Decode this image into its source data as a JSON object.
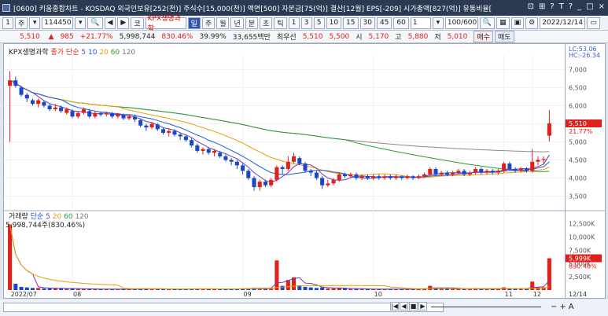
{
  "window": {
    "title": "[0600] 키움종합차트 - KOSDAQ 외국인보유[252(천)] 주식수[15,000(천)] 액면[500] 자본금[75(억)] 결산[12월] EPS[-209] 시가총액[827(억)] 유통비율[",
    "controls": [
      "⊡",
      "⊞",
      "?",
      "T",
      "?",
      "_",
      "□",
      "×"
    ]
  },
  "toolbar": {
    "left_buttons": [
      "1",
      "주",
      "▾"
    ],
    "stock_code": "114450",
    "period_buttons": [
      "코",
      "KPX생명과학",
      "일",
      "주",
      "월",
      "년",
      "분",
      "초",
      "틱"
    ],
    "interval_buttons": [
      "1",
      "3",
      "5",
      "10",
      "15",
      "30",
      "45",
      "60"
    ],
    "interval_value": "1",
    "page_count": "100/600",
    "date": "2022/12/14"
  },
  "quote": {
    "price": "5,510",
    "change": "985",
    "change_pct": "+21.77%",
    "volume": "5,998,744",
    "vol_ratio": "830.46%",
    "turnover": "39.99%",
    "amount": "33,655백만",
    "best_ask_label": "최우선",
    "best_ask": "5,510",
    "best_bid": "5,500",
    "open_label": "시",
    "open": "5,170",
    "high_label": "고",
    "high": "5,880",
    "low_label": "저",
    "low": "5,010",
    "buy_button": "매수",
    "sell_button": "매도"
  },
  "price_panel": {
    "name": "KPX생명과학",
    "ma_type": "종가 단순",
    "ma_periods": [
      "5",
      "10",
      "20",
      "60",
      "120"
    ],
    "lc_label": "LC:53.06",
    "hc_label": "HC:-26.34",
    "y_ticks": [
      "7,000",
      "6,500",
      "6,000",
      "5,500",
      "5,000",
      "4,500",
      "4,000",
      "3,500"
    ],
    "last_price_tag": "5,510",
    "last_pct_tag": "21.77%"
  },
  "volume_panel": {
    "name": "거래량",
    "ma_type": "단순",
    "ma_periods": [
      "5",
      "20",
      "60",
      "120"
    ],
    "max_label": "5,998,744주(830.46%)",
    "y_ticks": [
      "12,500K",
      "10,000K",
      "7,500K",
      "5,000K",
      "2,500K"
    ],
    "last_vol_tag": "5,999K",
    "last_vol_pct": "830.46%"
  },
  "x_axis": {
    "labels": [
      "2022/07",
      "08",
      "09",
      "10",
      "11",
      "12"
    ],
    "right_label": "12/14"
  },
  "colors": {
    "up": "#e0201b",
    "down": "#1a47c8",
    "ma5": "#6a3ab8",
    "ma10": "#1f5ad8",
    "ma20": "#e8a000",
    "ma60": "#2a9a3a",
    "ma120": "#8a8a8a"
  },
  "chart_data": {
    "type": "candlestick",
    "ylim": [
      3250,
      7400
    ],
    "candles": [
      [
        6550,
        6700,
        6950,
        5000
      ],
      [
        6700,
        6550,
        6800,
        6500
      ],
      [
        6500,
        6300,
        6550,
        6250
      ],
      [
        6300,
        6200,
        6350,
        6100
      ],
      [
        6150,
        6050,
        6200,
        6000
      ],
      [
        6050,
        6150,
        6200,
        5950
      ],
      [
        6100,
        6000,
        6150,
        5950
      ],
      [
        6000,
        5900,
        6050,
        5850
      ],
      [
        5900,
        5950,
        6050,
        5850
      ],
      [
        5950,
        5850,
        6000,
        5800
      ],
      [
        5800,
        5900,
        5950,
        5750
      ],
      [
        5850,
        5700,
        5900,
        5650
      ],
      [
        5700,
        5800,
        5850,
        5650
      ],
      [
        5800,
        5900,
        5950,
        5750
      ],
      [
        5850,
        5700,
        5900,
        5650
      ],
      [
        5700,
        5800,
        5850,
        5650
      ],
      [
        5780,
        5750,
        5820,
        5700
      ],
      [
        5760,
        5800,
        5830,
        5700
      ],
      [
        5790,
        5700,
        5820,
        5650
      ],
      [
        5700,
        5760,
        5800,
        5650
      ],
      [
        5740,
        5650,
        5780,
        5600
      ],
      [
        5650,
        5700,
        5760,
        5600
      ],
      [
        5700,
        5620,
        5750,
        5550
      ],
      [
        5600,
        5450,
        5650,
        5400
      ],
      [
        5450,
        5400,
        5500,
        5300
      ],
      [
        5400,
        5500,
        5550,
        5350
      ],
      [
        5480,
        5350,
        5520,
        5300
      ],
      [
        5350,
        5250,
        5400,
        5200
      ],
      [
        5250,
        5300,
        5350,
        5150
      ],
      [
        5300,
        5200,
        5350,
        5150
      ],
      [
        5200,
        5150,
        5250,
        5050
      ],
      [
        5150,
        5050,
        5200,
        5000
      ],
      [
        5050,
        4900,
        5100,
        4850
      ],
      [
        4900,
        4750,
        4950,
        4700
      ],
      [
        4750,
        4800,
        4850,
        4650
      ],
      [
        4800,
        4700,
        4850,
        4650
      ],
      [
        4700,
        4750,
        4800,
        4600
      ],
      [
        4700,
        4600,
        4750,
        4550
      ],
      [
        4600,
        4500,
        4650,
        4450
      ],
      [
        4500,
        4450,
        4550,
        4350
      ],
      [
        4450,
        4350,
        4500,
        4250
      ],
      [
        4350,
        4200,
        4400,
        4100
      ],
      [
        4200,
        4000,
        4250,
        3950
      ],
      [
        4000,
        3750,
        4050,
        3650
      ],
      [
        3750,
        3900,
        3950,
        3650
      ],
      [
        3900,
        3800,
        3950,
        3750
      ],
      [
        3800,
        3950,
        4000,
        3750
      ],
      [
        3950,
        4300,
        4350,
        3900
      ],
      [
        4300,
        4250,
        4350,
        4100
      ],
      [
        4250,
        4450,
        4600,
        4200
      ],
      [
        4450,
        4600,
        4700,
        4400
      ],
      [
        4550,
        4400,
        4600,
        4350
      ],
      [
        4400,
        4200,
        4450,
        4150
      ],
      [
        4200,
        4150,
        4250,
        4050
      ],
      [
        4150,
        4000,
        4200,
        3950
      ],
      [
        4000,
        3800,
        4050,
        3700
      ],
      [
        3800,
        3850,
        3950,
        3750
      ],
      [
        3850,
        3950,
        4000,
        3800
      ],
      [
        3950,
        4100,
        4150,
        3900
      ],
      [
        4100,
        4050,
        4150,
        4000
      ],
      [
        4050,
        4100,
        4150,
        4000
      ],
      [
        4100,
        4000,
        4150,
        3950
      ],
      [
        4000,
        4050,
        4100,
        3950
      ],
      [
        4050,
        4000,
        4100,
        3950
      ],
      [
        4000,
        4050,
        4100,
        3950
      ],
      [
        4050,
        4000,
        4100,
        3950
      ],
      [
        4000,
        4050,
        4100,
        3950
      ],
      [
        4050,
        4000,
        4100,
        3950
      ],
      [
        4000,
        4050,
        4100,
        3950
      ],
      [
        4050,
        4000,
        4080,
        3950
      ],
      [
        4000,
        4050,
        4100,
        3970
      ],
      [
        4050,
        4000,
        4080,
        3950
      ],
      [
        4000,
        4050,
        4100,
        3970
      ],
      [
        4050,
        4100,
        4150,
        4000
      ],
      [
        4100,
        4250,
        4300,
        4050
      ],
      [
        4250,
        4100,
        4300,
        4050
      ],
      [
        4100,
        4150,
        4200,
        4050
      ],
      [
        4150,
        4100,
        4200,
        4050
      ],
      [
        4100,
        4150,
        4200,
        4050
      ],
      [
        4150,
        4200,
        4250,
        4100
      ],
      [
        4200,
        4100,
        4250,
        4050
      ],
      [
        4100,
        4150,
        4200,
        4050
      ],
      [
        4150,
        4250,
        4300,
        4100
      ],
      [
        4250,
        4150,
        4300,
        4100
      ],
      [
        4150,
        4200,
        4250,
        4100
      ],
      [
        4200,
        4150,
        4250,
        4100
      ],
      [
        4150,
        4200,
        4250,
        4100
      ],
      [
        4200,
        4400,
        4450,
        4150
      ],
      [
        4400,
        4250,
        4450,
        4200
      ],
      [
        4250,
        4200,
        4300,
        4150
      ],
      [
        4200,
        4250,
        4300,
        4150
      ],
      [
        4250,
        4200,
        4300,
        4150
      ],
      [
        4200,
        4450,
        4800,
        4150
      ],
      [
        4450,
        4500,
        4600,
        4350
      ],
      [
        4500,
        4525,
        4600,
        4400
      ],
      [
        5170,
        5510,
        5880,
        5010
      ]
    ],
    "volumes": [
      12.4,
      1.2,
      0.6,
      0.5,
      0.4,
      0.4,
      0.3,
      0.3,
      0.3,
      0.3,
      0.3,
      0.3,
      0.2,
      0.2,
      0.2,
      0.2,
      0.2,
      0.2,
      0.2,
      0.2,
      0.2,
      0.2,
      0.2,
      0.3,
      0.3,
      0.2,
      0.2,
      0.2,
      0.2,
      0.2,
      0.2,
      0.2,
      0.3,
      0.3,
      0.2,
      0.2,
      0.2,
      0.2,
      0.2,
      0.2,
      0.3,
      0.3,
      0.3,
      0.4,
      0.3,
      0.3,
      0.3,
      5.6,
      0.8,
      1.9,
      2.4,
      0.9,
      0.6,
      0.5,
      0.4,
      0.5,
      0.3,
      0.3,
      0.4,
      0.3,
      0.2,
      0.2,
      0.2,
      0.2,
      0.2,
      0.2,
      0.2,
      0.2,
      0.2,
      0.2,
      0.2,
      0.2,
      0.3,
      0.3,
      0.8,
      0.4,
      0.3,
      0.3,
      0.3,
      0.3,
      0.2,
      0.2,
      0.3,
      0.2,
      0.2,
      0.2,
      0.2,
      0.5,
      0.3,
      0.2,
      0.2,
      0.2,
      1.6,
      0.6,
      0.5,
      6.0
    ],
    "vol_ylim": [
      0,
      13500
    ]
  }
}
